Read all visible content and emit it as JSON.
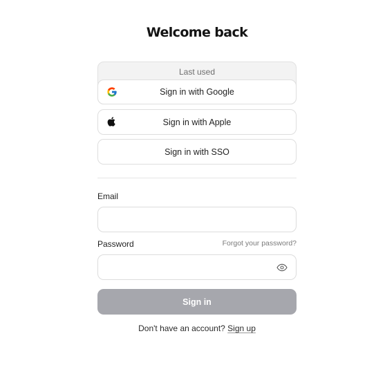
{
  "title": "Welcome back",
  "last_used": {
    "label": "Last used"
  },
  "providers": {
    "google": {
      "label": "Sign in with Google",
      "icon": "google-icon"
    },
    "apple": {
      "label": "Sign in with Apple",
      "icon": "apple-icon"
    },
    "sso": {
      "label": "Sign in with SSO"
    }
  },
  "form": {
    "email_label": "Email",
    "email_value": "",
    "password_label": "Password",
    "password_value": "",
    "forgot_link": "Forgot your password?",
    "password_toggle_icon": "eye-icon",
    "submit_label": "Sign in"
  },
  "footer": {
    "prompt": "Don't have an account?",
    "signup_link": "Sign up"
  },
  "colors": {
    "submit_disabled": "#a6a7ad",
    "last_used_bg": "#f3f3f3",
    "border": "#dedede"
  }
}
